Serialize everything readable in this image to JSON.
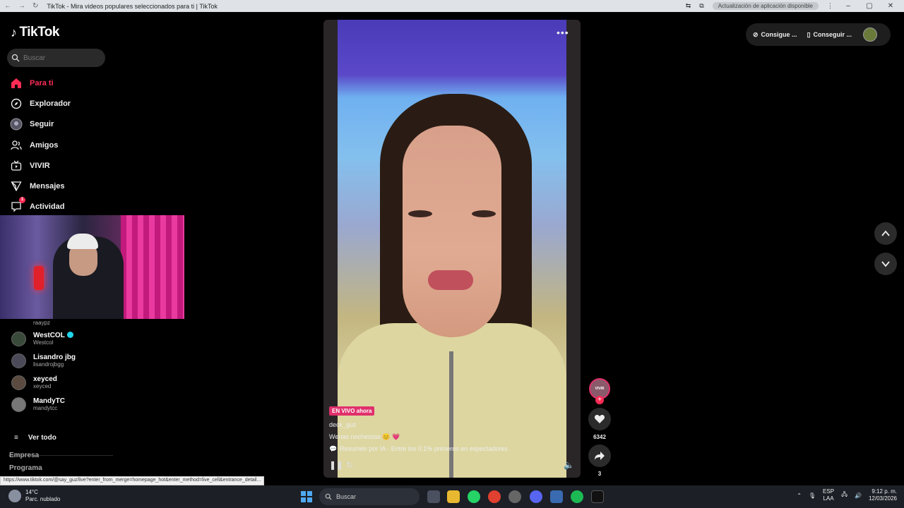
{
  "browser": {
    "tab_title": "TikTok - Mira videos populares seleccionados para ti | TikTok",
    "update_label": "Actualización de aplicación disponible"
  },
  "sidebar": {
    "logo": "TikTok",
    "search_placeholder": "Buscar",
    "nav": [
      {
        "label": "Para ti",
        "icon": "home-icon"
      },
      {
        "label": "Explorador",
        "icon": "compass-icon"
      },
      {
        "label": "Seguir",
        "icon": "following-avatar-icon"
      },
      {
        "label": "Amigos",
        "icon": "friends-icon"
      },
      {
        "label": "VIVIR",
        "icon": "live-tv-icon"
      },
      {
        "label": "Mensajes",
        "icon": "send-icon"
      },
      {
        "label": "Actividad",
        "icon": "inbox-icon",
        "badge": "1"
      }
    ],
    "partial_user": "raaypz",
    "following": [
      {
        "name": "WestCOL",
        "user": "Westcol",
        "verified": true
      },
      {
        "name": "Lisandro jbg",
        "user": "lisandrojbgg",
        "verified": false
      },
      {
        "name": "xeyced",
        "user": "xeyced",
        "verified": false
      },
      {
        "name": "MandyTC",
        "user": "mandytcc",
        "verified": false
      }
    ],
    "see_all": "Ver todo",
    "footer": [
      "Empresa",
      "Programa"
    ]
  },
  "status_url": "https://www.tiktok.com/@say_guz/live?enter_from_merge=homepage_hot&enter_method=live_cell&entrance_detail...",
  "video": {
    "live_badge": "EN VIVO ahora",
    "username": "deck_guz",
    "description": "Wenas nochessss 😊 💗",
    "ai_summary": "Resumen por IA · Entre los 0.1% primeros en espectadores"
  },
  "actions": {
    "live_label": "VIVIR",
    "likes": "6342",
    "shares": "3"
  },
  "top_right": {
    "coins": "Consigue ...",
    "app": "Conseguir ..."
  },
  "taskbar": {
    "temp": "14°C",
    "weather": "Parc. nublado",
    "search": "Buscar",
    "lang1": "ESP",
    "lang2": "LAA",
    "time": "9:12 p. m.",
    "date": "12/03/2026"
  }
}
